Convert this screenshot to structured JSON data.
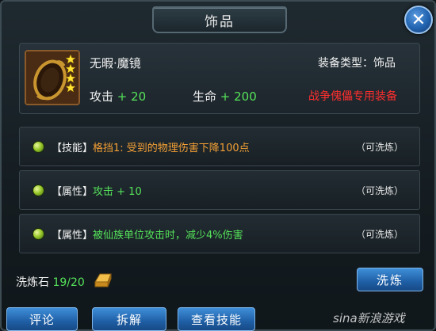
{
  "dialog": {
    "title": "饰品",
    "close_icon": "close-icon"
  },
  "item": {
    "name": "无暇·魔镜",
    "type_label": "装备类型：饰品",
    "stars": 4,
    "stats": {
      "attack_label": "攻击",
      "attack_value": "+ 20",
      "hp_label": "生命",
      "hp_value": "+ 200"
    },
    "exclusive_note": "战争傀儡专用装备"
  },
  "attributes": [
    {
      "tag": "【技能】",
      "desc": "格挡1: 受到的物理伤害下降100点",
      "wash": "（可洗炼）"
    },
    {
      "tag": "【属性】",
      "desc": "攻击 + 10",
      "wash": "（可洗炼）"
    },
    {
      "tag": "【属性】",
      "desc": "被仙族单位攻击时，减少4%伤害",
      "wash": "（可洗炼）"
    }
  ],
  "refine": {
    "stone_label": "洗炼石",
    "stone_count": "19/20",
    "button_label": "洗炼"
  },
  "bottom": {
    "comment": "评论",
    "dismantle": "拆解",
    "view_skills": "查看技能"
  },
  "watermark": "sina新浪游戏",
  "colors": {
    "green": "#55e25a",
    "orange": "#f5a035",
    "red": "#ff2e2e",
    "button_blue": "#1f5fa6"
  }
}
